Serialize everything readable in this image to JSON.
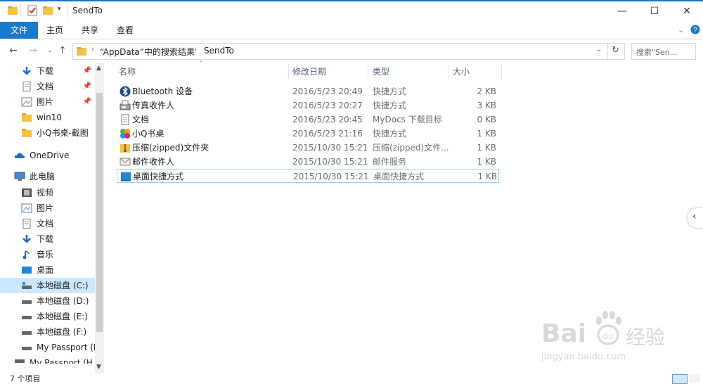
{
  "window": {
    "title": "SendTo",
    "controls": {
      "minimize": "—",
      "maximize": "☐",
      "close": "✕"
    }
  },
  "ribbon": {
    "tabs": [
      "文件",
      "主页",
      "共享",
      "查看"
    ]
  },
  "address": {
    "path": [
      "“AppData”中的搜索结果",
      "SendTo"
    ],
    "search_placeholder": "搜索\"Sen..."
  },
  "nav": {
    "quick_access": [
      {
        "label": "下载",
        "icon": "download-icon",
        "pinned": true
      },
      {
        "label": "文档",
        "icon": "document-icon",
        "pinned": true
      },
      {
        "label": "图片",
        "icon": "pictures-icon",
        "pinned": true
      },
      {
        "label": "win10",
        "icon": "folder-icon",
        "pinned": false
      },
      {
        "label": "小Q书桌-截图",
        "icon": "folder-icon",
        "pinned": false
      }
    ],
    "onedrive": "OneDrive",
    "this_pc": "此电脑",
    "pc_items": [
      {
        "label": "视频",
        "icon": "video-icon"
      },
      {
        "label": "图片",
        "icon": "pictures-icon"
      },
      {
        "label": "文档",
        "icon": "document-icon"
      },
      {
        "label": "下载",
        "icon": "download-icon"
      },
      {
        "label": "音乐",
        "icon": "music-icon"
      },
      {
        "label": "桌面",
        "icon": "desktop-icon"
      },
      {
        "label": "本地磁盘 (C:)",
        "icon": "drive-c-icon"
      },
      {
        "label": "本地磁盘 (D:)",
        "icon": "drive-icon"
      },
      {
        "label": "本地磁盘 (E:)",
        "icon": "drive-icon"
      },
      {
        "label": "本地磁盘 (F:)",
        "icon": "drive-icon"
      },
      {
        "label": "My Passport (H",
        "icon": "drive-icon"
      },
      {
        "label": "My Passport (H",
        "icon": "drive-icon"
      }
    ]
  },
  "columns": [
    "名称",
    "修改日期",
    "类型",
    "大小"
  ],
  "files": [
    {
      "name": "Bluetooth 设备",
      "date": "2016/5/23 20:49",
      "type": "快捷方式",
      "size": "2 KB",
      "icon": "bluetooth-icon"
    },
    {
      "name": "传真收件人",
      "date": "2016/5/23 20:27",
      "type": "快捷方式",
      "size": "3 KB",
      "icon": "fax-icon"
    },
    {
      "name": "文档",
      "date": "2016/5/23 20:45",
      "type": "MyDocs 下载目标",
      "size": "0 KB",
      "icon": "document-icon"
    },
    {
      "name": "小Q书桌",
      "date": "2016/5/23 21:16",
      "type": "快捷方式",
      "size": "1 KB",
      "icon": "app-icon"
    },
    {
      "name": "压缩(zipped)文件夹",
      "date": "2015/10/30 15:21",
      "type": "压缩(zipped)文件...",
      "size": "1 KB",
      "icon": "zip-folder-icon"
    },
    {
      "name": "邮件收件人",
      "date": "2015/10/30 15:21",
      "type": "邮件服务",
      "size": "1 KB",
      "icon": "mail-icon"
    },
    {
      "name": "桌面快捷方式",
      "date": "2015/10/30 15:21",
      "type": "桌面快捷方式",
      "size": "1 KB",
      "icon": "desktop-icon"
    }
  ],
  "status": {
    "item_count": "7 个项目"
  },
  "watermark": {
    "brand": "Bai",
    "brand2": "经验",
    "url": "jingyan.baidu.com"
  },
  "colors": {
    "accent": "#1979ca",
    "selection": "#cce8ff",
    "row_border": "#99d1ff"
  }
}
